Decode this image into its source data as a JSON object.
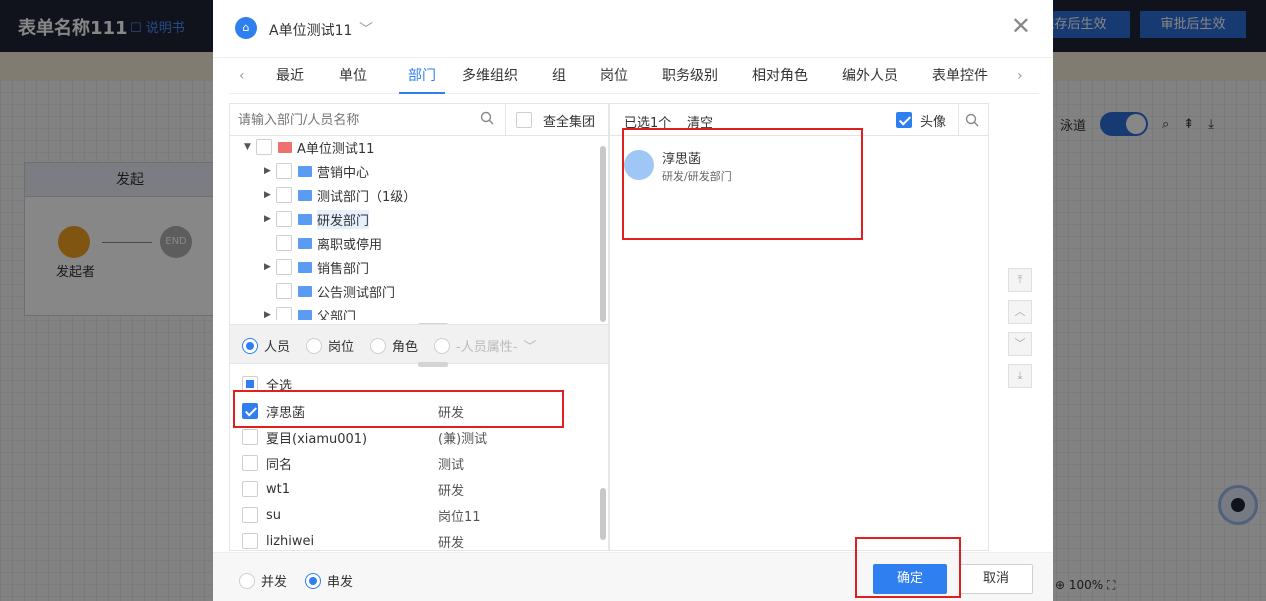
{
  "app": {
    "title": "表单名称111",
    "manual": "说明书",
    "save_btn": "保存后生效",
    "approve_btn": "审批后生效"
  },
  "canvas": {
    "flow_header": "发起",
    "start_label": "发起者",
    "end_label": "END",
    "toggle_label": "泳道",
    "zoom": "100%"
  },
  "dialog": {
    "unit_name": "A单位测试11",
    "tabs": [
      {
        "label": "最近"
      },
      {
        "label": "单位"
      },
      {
        "label": "部门",
        "active": true
      },
      {
        "label": "多维组织"
      },
      {
        "label": "组"
      },
      {
        "label": "岗位"
      },
      {
        "label": "职务级别"
      },
      {
        "label": "相对角色"
      },
      {
        "label": "编外人员"
      },
      {
        "label": "表单控件"
      }
    ],
    "search_placeholder": "请输入部门/人员名称",
    "group_label": "查全集团",
    "tree": [
      {
        "label": "A单位测试11",
        "level": 0,
        "expanded": true,
        "icon": "unit-icon"
      },
      {
        "label": "营销中心",
        "level": 1,
        "has_children": true
      },
      {
        "label": "测试部门（1级）",
        "level": 1,
        "has_children": true
      },
      {
        "label": "研发部门",
        "level": 1,
        "has_children": true,
        "highlighted": true
      },
      {
        "label": "离职或停用",
        "level": 1,
        "has_children": false
      },
      {
        "label": "销售部门",
        "level": 1,
        "has_children": true
      },
      {
        "label": "公告测试部门",
        "level": 1,
        "has_children": false
      },
      {
        "label": "父部门",
        "level": 1,
        "has_children": true
      }
    ],
    "filters": {
      "person": "人员",
      "post": "岗位",
      "role": "角色",
      "attr": "-人员属性-",
      "selected": "人员"
    },
    "select_all": "全选",
    "people": [
      {
        "name": "淳思菡",
        "dept": "研发",
        "checked": true
      },
      {
        "name": "夏目(xiamu001)",
        "dept": "(兼)测试",
        "checked": false
      },
      {
        "name": "同名",
        "dept": "测试",
        "checked": false
      },
      {
        "name": "wt1",
        "dept": "研发",
        "checked": false
      },
      {
        "name": "su",
        "dept": "岗位11",
        "checked": false
      },
      {
        "name": "lizhiwei",
        "dept": "研发",
        "checked": false
      }
    ],
    "selected": {
      "count_text": "已选1个",
      "clear": "清空",
      "avatar_label": "头像",
      "items": [
        {
          "name": "淳思菡",
          "path": "研发/研发部门"
        }
      ]
    },
    "footer": {
      "parallel": "并发",
      "serial": "串发",
      "mode": "串发",
      "ok": "确定",
      "cancel": "取消"
    }
  },
  "colors": {
    "primary": "#2f7ff0",
    "header_bg": "#1f2433",
    "highlight_box": "#e02020"
  }
}
